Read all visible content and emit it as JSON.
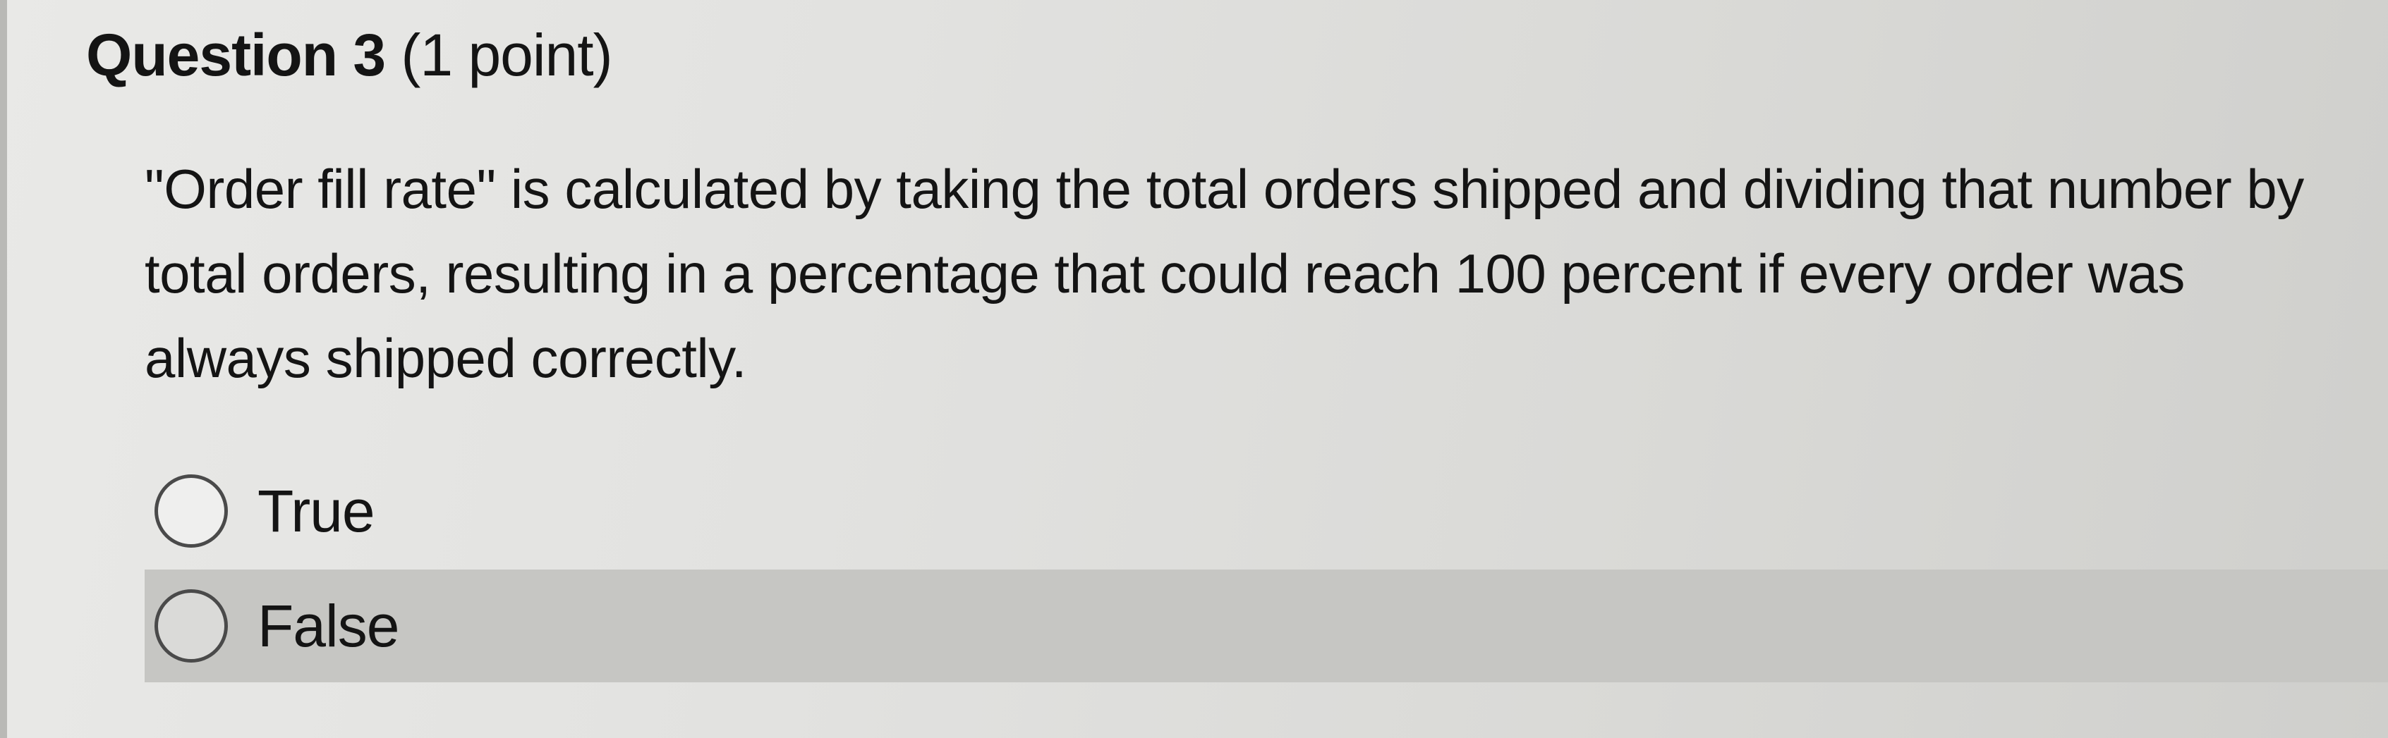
{
  "question": {
    "title": "Question 3",
    "points": "(1 point)",
    "text": "\"Order fill rate\" is calculated by taking the total orders shipped and dividing that number by total orders, resulting in a percentage that could reach 100 percent if every order was always shipped correctly."
  },
  "options": [
    {
      "label": "True",
      "selected": false
    },
    {
      "label": "False",
      "selected": false,
      "highlighted": true
    }
  ],
  "colors": {
    "text": "#141414",
    "hover_row": "#c6c6c3",
    "radio_border": "#4a4a4a"
  }
}
